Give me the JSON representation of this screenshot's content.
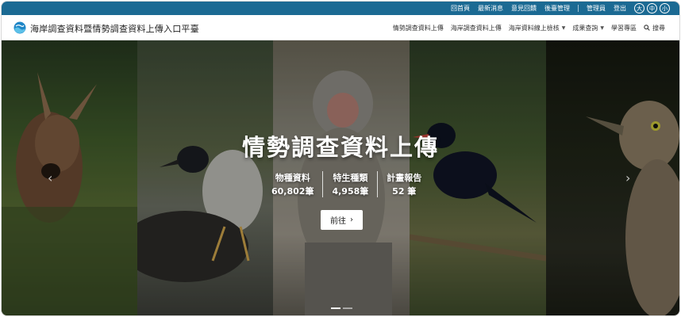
{
  "topbar": {
    "links": [
      "回首頁",
      "最新消息",
      "意見回饋",
      "後臺管理"
    ],
    "user_links": [
      "管理員",
      "登出"
    ],
    "font_sizes": [
      "大",
      "中",
      "小"
    ]
  },
  "header": {
    "site_title": "海岸調查資料暨情勢調查資料上傳入口平臺",
    "nav": [
      {
        "label": "情勢調查資料上傳",
        "dropdown": false
      },
      {
        "label": "海岸調查資料上傳",
        "dropdown": false
      },
      {
        "label": "海岸資料線上檢核",
        "dropdown": true
      },
      {
        "label": "成果查詢",
        "dropdown": true
      },
      {
        "label": "學習專區",
        "dropdown": false
      }
    ],
    "search_label": "搜尋"
  },
  "hero": {
    "title": "情勢調查資料上傳",
    "stats": [
      {
        "label": "物種資料",
        "value": "60,802筆"
      },
      {
        "label": "特生種類",
        "value": "4,958筆"
      },
      {
        "label": "計畫報告",
        "value": "52 筆"
      }
    ],
    "button_label": "前往",
    "button_icon": "chevron-right-icon",
    "slides_count": 2,
    "active_slide": 1
  },
  "colors": {
    "topbar": "#1b6a93",
    "header_bg": "#ffffff",
    "button_bg": "#ffffff"
  }
}
